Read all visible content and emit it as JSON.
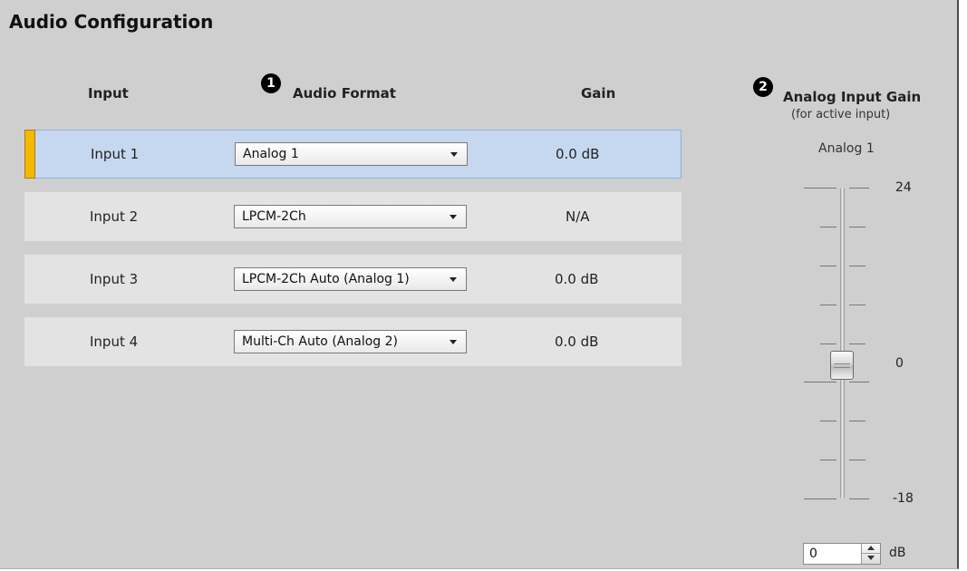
{
  "panel": {
    "title": "Audio Configuration"
  },
  "columns": {
    "input": "Input",
    "audio_format": "Audio Format",
    "gain": "Gain"
  },
  "badges": {
    "one": "1",
    "two": "2"
  },
  "rows": [
    {
      "input": "Input 1",
      "format": "Analog 1",
      "gain": "0.0  dB",
      "active": true
    },
    {
      "input": "Input 2",
      "format": "LPCM-2Ch",
      "gain": "N/A",
      "active": false
    },
    {
      "input": "Input 3",
      "format": "LPCM-2Ch Auto (Analog 1)",
      "gain": "0.0  dB",
      "active": false
    },
    {
      "input": "Input 4",
      "format": "Multi-Ch Auto (Analog 2)",
      "gain": "0.0  dB",
      "active": false
    }
  ],
  "analog_gain": {
    "title": "Analog Input Gain",
    "subtitle": "(for active input)",
    "active_format": "Analog 1",
    "scale_max": "24",
    "scale_zero": "0",
    "scale_min": "-18",
    "range": [
      -18,
      24
    ],
    "value": 0,
    "spin_value": "0",
    "unit": "dB"
  },
  "colors": {
    "panel_bg": "#cfcfcf",
    "row_bg": "#e3e3e3",
    "active_row_bg": "#c6d8ef",
    "active_marker": "#f5b800"
  }
}
